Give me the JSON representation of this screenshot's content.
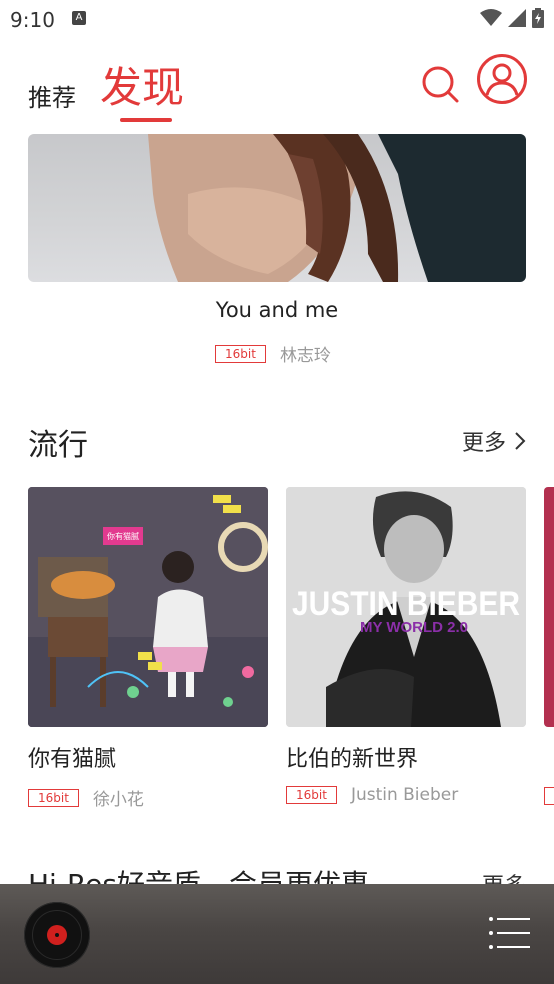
{
  "status_bar": {
    "time": "9:10",
    "notification_icon": "A"
  },
  "header": {
    "tab_recommend": "推荐",
    "tab_discover": "发现"
  },
  "hero": {
    "title": "You and me",
    "badge": "16bit",
    "artist": "林志玲"
  },
  "section": {
    "title": "流行",
    "more": "更多"
  },
  "albums": [
    {
      "title": "你有猫腻",
      "badge": "16bit",
      "artist": "徐小花",
      "cover_text": "你有猫腻"
    },
    {
      "title": "比伯的新世界",
      "badge": "16bit",
      "artist": "Justin Bieber",
      "cover_text_main": "JUSTIN BIEBER",
      "cover_text_sub": "MY WORLD 2.0"
    }
  ],
  "next_section": {
    "title": "Hi-Res好音质，会员更优惠",
    "more": "更多"
  },
  "colors": {
    "accent": "#e23a3a",
    "player_bg": "#4a4644"
  },
  "icons": [
    "search-icon",
    "user-avatar-icon",
    "chevron-right-icon",
    "vinyl-disc-icon",
    "playlist-icon",
    "wifi-icon",
    "signal-icon",
    "battery-icon"
  ]
}
